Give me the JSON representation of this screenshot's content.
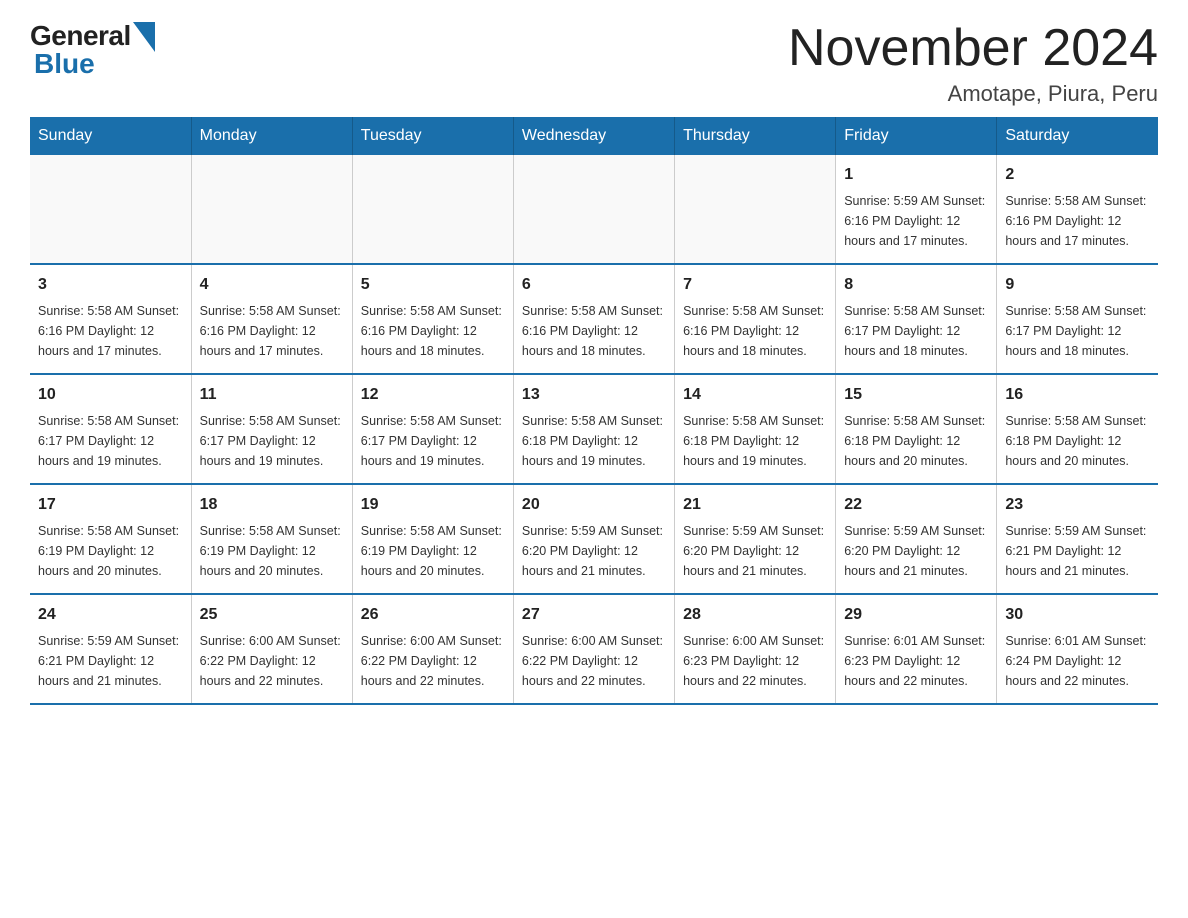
{
  "header": {
    "logo_general": "General",
    "logo_blue": "Blue",
    "month_title": "November 2024",
    "location": "Amotape, Piura, Peru"
  },
  "days_of_week": [
    "Sunday",
    "Monday",
    "Tuesday",
    "Wednesday",
    "Thursday",
    "Friday",
    "Saturday"
  ],
  "weeks": [
    [
      {
        "day": "",
        "info": ""
      },
      {
        "day": "",
        "info": ""
      },
      {
        "day": "",
        "info": ""
      },
      {
        "day": "",
        "info": ""
      },
      {
        "day": "",
        "info": ""
      },
      {
        "day": "1",
        "info": "Sunrise: 5:59 AM\nSunset: 6:16 PM\nDaylight: 12 hours\nand 17 minutes."
      },
      {
        "day": "2",
        "info": "Sunrise: 5:58 AM\nSunset: 6:16 PM\nDaylight: 12 hours\nand 17 minutes."
      }
    ],
    [
      {
        "day": "3",
        "info": "Sunrise: 5:58 AM\nSunset: 6:16 PM\nDaylight: 12 hours\nand 17 minutes."
      },
      {
        "day": "4",
        "info": "Sunrise: 5:58 AM\nSunset: 6:16 PM\nDaylight: 12 hours\nand 17 minutes."
      },
      {
        "day": "5",
        "info": "Sunrise: 5:58 AM\nSunset: 6:16 PM\nDaylight: 12 hours\nand 18 minutes."
      },
      {
        "day": "6",
        "info": "Sunrise: 5:58 AM\nSunset: 6:16 PM\nDaylight: 12 hours\nand 18 minutes."
      },
      {
        "day": "7",
        "info": "Sunrise: 5:58 AM\nSunset: 6:16 PM\nDaylight: 12 hours\nand 18 minutes."
      },
      {
        "day": "8",
        "info": "Sunrise: 5:58 AM\nSunset: 6:17 PM\nDaylight: 12 hours\nand 18 minutes."
      },
      {
        "day": "9",
        "info": "Sunrise: 5:58 AM\nSunset: 6:17 PM\nDaylight: 12 hours\nand 18 minutes."
      }
    ],
    [
      {
        "day": "10",
        "info": "Sunrise: 5:58 AM\nSunset: 6:17 PM\nDaylight: 12 hours\nand 19 minutes."
      },
      {
        "day": "11",
        "info": "Sunrise: 5:58 AM\nSunset: 6:17 PM\nDaylight: 12 hours\nand 19 minutes."
      },
      {
        "day": "12",
        "info": "Sunrise: 5:58 AM\nSunset: 6:17 PM\nDaylight: 12 hours\nand 19 minutes."
      },
      {
        "day": "13",
        "info": "Sunrise: 5:58 AM\nSunset: 6:18 PM\nDaylight: 12 hours\nand 19 minutes."
      },
      {
        "day": "14",
        "info": "Sunrise: 5:58 AM\nSunset: 6:18 PM\nDaylight: 12 hours\nand 19 minutes."
      },
      {
        "day": "15",
        "info": "Sunrise: 5:58 AM\nSunset: 6:18 PM\nDaylight: 12 hours\nand 20 minutes."
      },
      {
        "day": "16",
        "info": "Sunrise: 5:58 AM\nSunset: 6:18 PM\nDaylight: 12 hours\nand 20 minutes."
      }
    ],
    [
      {
        "day": "17",
        "info": "Sunrise: 5:58 AM\nSunset: 6:19 PM\nDaylight: 12 hours\nand 20 minutes."
      },
      {
        "day": "18",
        "info": "Sunrise: 5:58 AM\nSunset: 6:19 PM\nDaylight: 12 hours\nand 20 minutes."
      },
      {
        "day": "19",
        "info": "Sunrise: 5:58 AM\nSunset: 6:19 PM\nDaylight: 12 hours\nand 20 minutes."
      },
      {
        "day": "20",
        "info": "Sunrise: 5:59 AM\nSunset: 6:20 PM\nDaylight: 12 hours\nand 21 minutes."
      },
      {
        "day": "21",
        "info": "Sunrise: 5:59 AM\nSunset: 6:20 PM\nDaylight: 12 hours\nand 21 minutes."
      },
      {
        "day": "22",
        "info": "Sunrise: 5:59 AM\nSunset: 6:20 PM\nDaylight: 12 hours\nand 21 minutes."
      },
      {
        "day": "23",
        "info": "Sunrise: 5:59 AM\nSunset: 6:21 PM\nDaylight: 12 hours\nand 21 minutes."
      }
    ],
    [
      {
        "day": "24",
        "info": "Sunrise: 5:59 AM\nSunset: 6:21 PM\nDaylight: 12 hours\nand 21 minutes."
      },
      {
        "day": "25",
        "info": "Sunrise: 6:00 AM\nSunset: 6:22 PM\nDaylight: 12 hours\nand 22 minutes."
      },
      {
        "day": "26",
        "info": "Sunrise: 6:00 AM\nSunset: 6:22 PM\nDaylight: 12 hours\nand 22 minutes."
      },
      {
        "day": "27",
        "info": "Sunrise: 6:00 AM\nSunset: 6:22 PM\nDaylight: 12 hours\nand 22 minutes."
      },
      {
        "day": "28",
        "info": "Sunrise: 6:00 AM\nSunset: 6:23 PM\nDaylight: 12 hours\nand 22 minutes."
      },
      {
        "day": "29",
        "info": "Sunrise: 6:01 AM\nSunset: 6:23 PM\nDaylight: 12 hours\nand 22 minutes."
      },
      {
        "day": "30",
        "info": "Sunrise: 6:01 AM\nSunset: 6:24 PM\nDaylight: 12 hours\nand 22 minutes."
      }
    ]
  ]
}
